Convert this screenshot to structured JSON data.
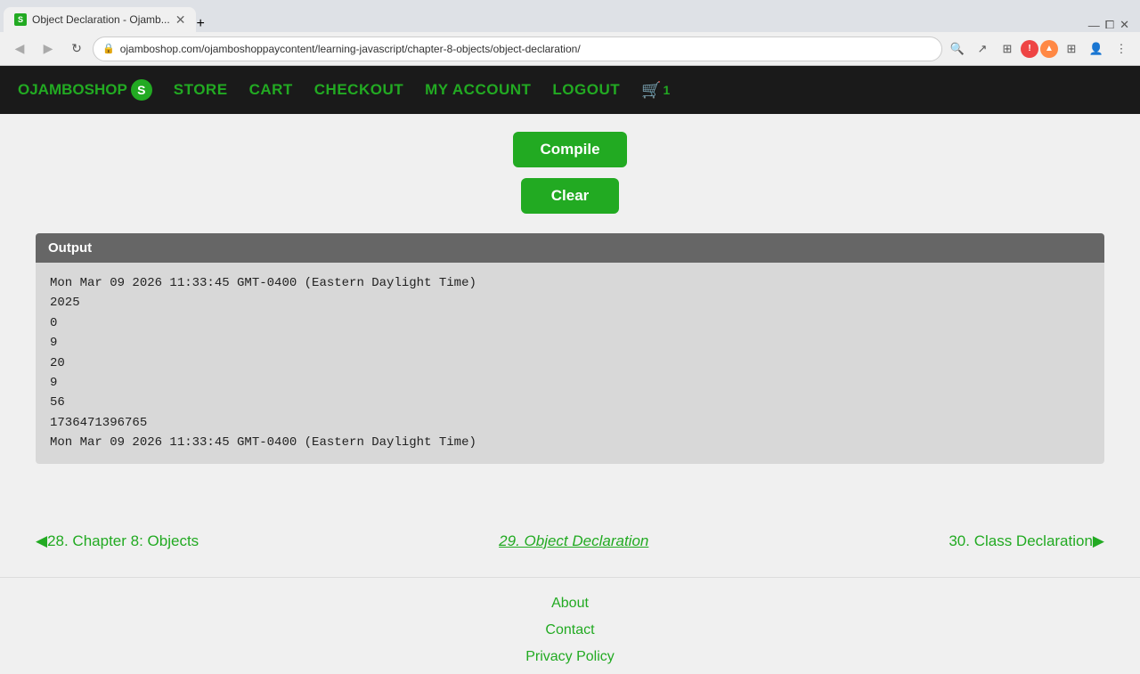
{
  "browser": {
    "tab_title": "Object Declaration - Ojamb...",
    "tab_favicon": "S",
    "url": "ojamboshop.com/ojamboshoppaycontent/learning-javascript/chapter-8-objects/object-declaration/",
    "back_btn": "◀",
    "forward_btn": "▶",
    "refresh_btn": "↻"
  },
  "nav": {
    "logo_text": "OJAMBOSHOP",
    "logo_s": "S",
    "links": [
      "STORE",
      "CART",
      "CHECKOUT",
      "MY ACCOUNT",
      "LOGOUT"
    ],
    "cart_count": "1"
  },
  "buttons": {
    "compile_label": "Compile",
    "clear_label": "Clear"
  },
  "output": {
    "header": "Output",
    "lines": [
      "Mon Mar 09 2026 11:33:45 GMT-0400 (Eastern Daylight Time)",
      "2025",
      "0",
      "9",
      "20",
      "9",
      "56",
      "1736471396765",
      "Mon Mar 09 2026 11:33:45 GMT-0400 (Eastern Daylight Time)"
    ]
  },
  "chapter_nav": {
    "prev_label": "◀28. Chapter 8: Objects",
    "current_label": "29. Object Declaration",
    "next_label": "30. Class Declaration▶"
  },
  "footer": {
    "links": [
      "About",
      "Contact",
      "Privacy Policy"
    ]
  }
}
